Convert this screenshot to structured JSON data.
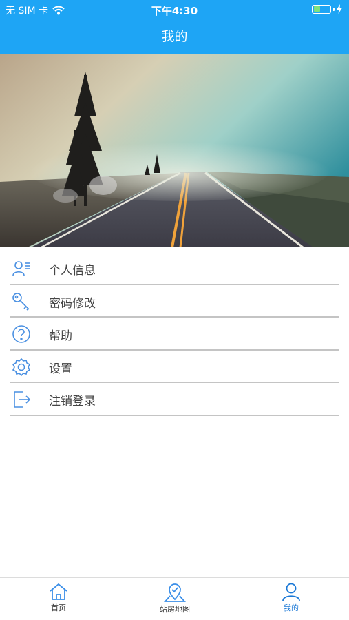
{
  "status_bar": {
    "carrier": "无 SIM 卡",
    "time": "下午4:30"
  },
  "nav": {
    "title": "我的"
  },
  "menu": {
    "items": [
      {
        "label": "个人信息",
        "icon": "user-list-icon"
      },
      {
        "label": "密码修改",
        "icon": "key-icon"
      },
      {
        "label": "帮助",
        "icon": "help-circle-icon"
      },
      {
        "label": "设置",
        "icon": "gear-icon"
      },
      {
        "label": "注销登录",
        "icon": "logout-icon"
      }
    ]
  },
  "tabbar": {
    "tabs": [
      {
        "label": "首页",
        "icon": "home-icon",
        "active": false
      },
      {
        "label": "站房地图",
        "icon": "map-pin-icon",
        "active": false
      },
      {
        "label": "我的",
        "icon": "person-icon",
        "active": true
      }
    ]
  },
  "colors": {
    "primary": "#1ea5f5",
    "icon_blue": "#4a90e2",
    "active_tab": "#1a78d6"
  }
}
